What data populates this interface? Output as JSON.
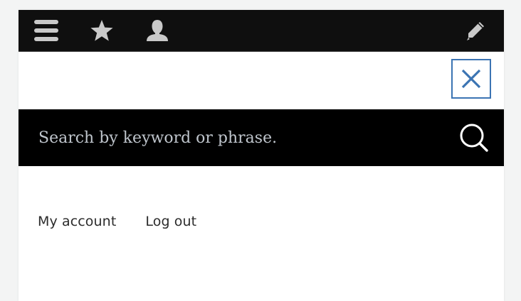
{
  "toolbar": {
    "icons": {
      "menu": "hamburger-menu-icon",
      "shortcuts": "star-icon",
      "user": "user-icon",
      "edit": "pencil-icon"
    },
    "icon_color": "#c9c9c9",
    "background": "#0f0f0f"
  },
  "close": {
    "icon": "close-icon",
    "color": "#3b74b3"
  },
  "search": {
    "placeholder": "Search by keyword or phrase.",
    "value": "",
    "icon": "search-icon"
  },
  "account_menu": {
    "items": [
      {
        "label": "My account"
      },
      {
        "label": "Log out"
      }
    ]
  }
}
